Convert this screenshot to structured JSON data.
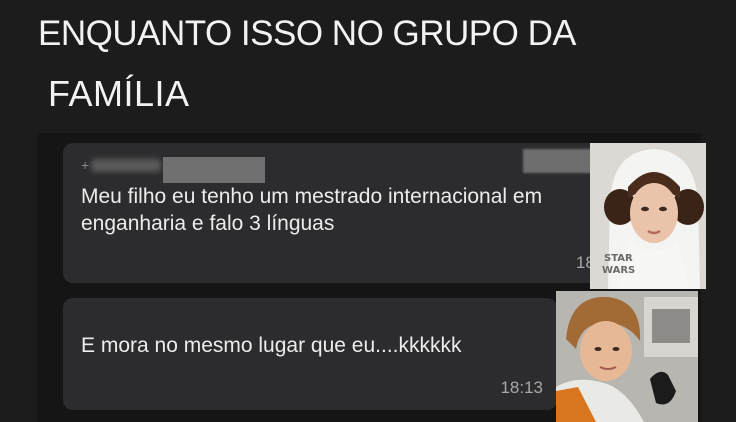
{
  "caption": {
    "line1": "ENQUANTO ISSO NO GRUPO D",
    "line1_end": "A",
    "line2": "FAMÍLIA"
  },
  "messages": [
    {
      "sender_prefix": "+",
      "text": "Meu filho eu tenho um mestrado internacional em enganharia e falo 3 línguas",
      "time": "18:1"
    },
    {
      "text": "E mora no mesmo lugar que eu....kkkkkk",
      "time": "18:13"
    }
  ],
  "photos": {
    "leia_badge_line1": "STAR",
    "leia_badge_line2": "WARS"
  }
}
